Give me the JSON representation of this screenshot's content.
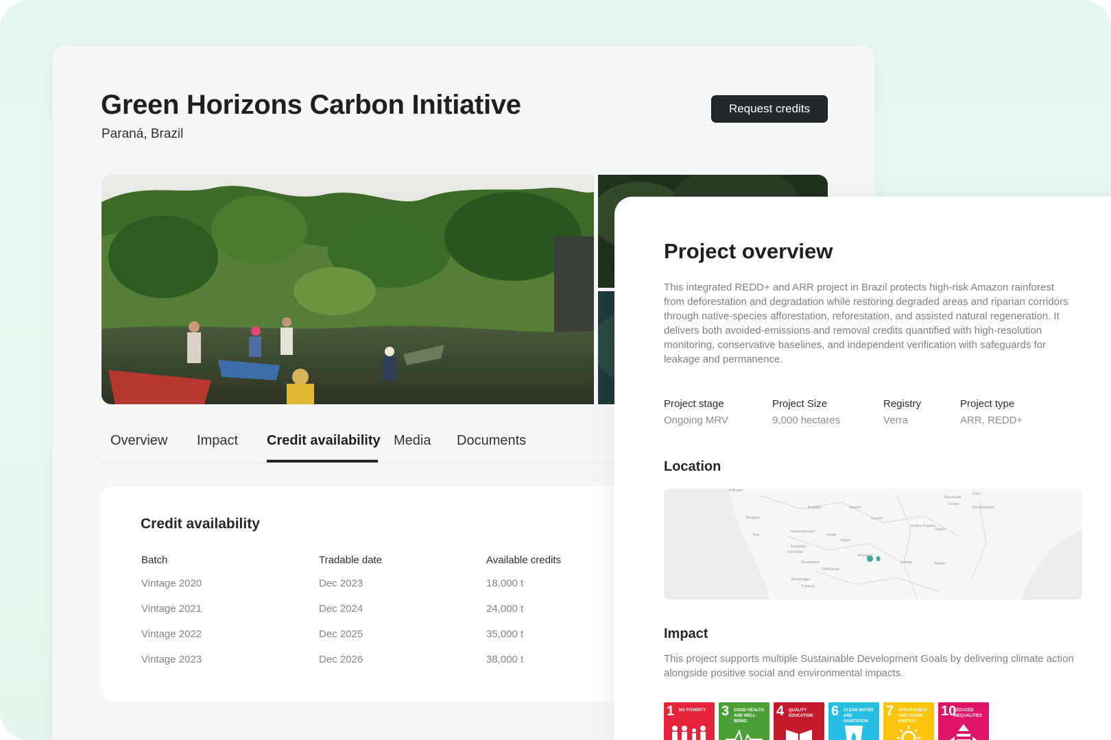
{
  "project": {
    "title": "Green Horizons Carbon Initiative",
    "location": "Paraná, Brazil",
    "request_label": "Request credits"
  },
  "tabs": [
    {
      "label": "Overview"
    },
    {
      "label": "Impact"
    },
    {
      "label": "Credit availability",
      "active": true
    },
    {
      "label": "Media"
    },
    {
      "label": "Documents"
    }
  ],
  "credits": {
    "title": "Credit availability",
    "headers": [
      "Batch",
      "Tradable date",
      "Available credits"
    ],
    "rows": [
      [
        "Vintage 2020",
        "Dec 2023",
        "18,000 t"
      ],
      [
        "Vintage 2021",
        "Dec 2024",
        "24,000 t"
      ],
      [
        "Vintage 2022",
        "Dec 2025",
        "35,000 t"
      ],
      [
        "Vintage 2023",
        "Dec 2026",
        "38,000 t"
      ]
    ]
  },
  "overview": {
    "title": "Project overview",
    "description": "This integrated REDD+ and ARR project in Brazil protects high-risk Amazon rainforest from deforestation and degradation while restoring degraded areas and riparian corridors through native-species afforestation, reforestation, and assisted natural regeneration. It delivers both avoided-emissions and removal credits quantified with high-resolution monitoring, conservative baselines, and independent verification with safeguards for leakage and permanence.",
    "meta": [
      {
        "label": "Project stage",
        "value": "Ongoing MRV"
      },
      {
        "label": "Project Size",
        "value": "9,000 hectares"
      },
      {
        "label": "Registry",
        "value": "Verra"
      },
      {
        "label": "Project type",
        "value": "ARR, REDD+"
      }
    ],
    "location_heading": "Location",
    "map_labels": [
      "Kolhapur",
      "Bagalkot",
      "Raichur",
      "Vijayawada",
      "Guntur",
      "Machilipatnam",
      "Belagavi",
      "Gadag-Betageri",
      "Kurnool",
      "Karnataka",
      "Hampi",
      "Andhra Pradesh",
      "Ongole",
      "Karnataka",
      "Ballari",
      "Anantapur",
      "Kadapa",
      "Nellore",
      "Davanagere",
      "Chitradurga",
      "Shivamogga",
      "Tumkuru",
      "Goa",
      "Eluru"
    ],
    "impact_heading": "Impact",
    "impact_description": "This project supports multiple Sustainable Development Goals by delivering climate action alongside positive social and environmental impacts.",
    "sdgs": [
      {
        "num": "1",
        "label": "No poverty",
        "color": "#e5243b",
        "icon": "people-icon"
      },
      {
        "num": "3",
        "label": "Good health and well-being",
        "color": "#4c9f38",
        "icon": "heartbeat-icon"
      },
      {
        "num": "4",
        "label": "Quality education",
        "color": "#c5192d",
        "icon": "book-icon"
      },
      {
        "num": "6",
        "label": "Clean water and sanitation",
        "color": "#26bde2",
        "icon": "water-drop-icon"
      },
      {
        "num": "7",
        "label": "Affordable and clean energy",
        "color": "#fcc30b",
        "icon": "sun-icon"
      },
      {
        "num": "10",
        "label": "Reduced inequalities",
        "color": "#dd1367",
        "icon": "equality-icon"
      }
    ]
  }
}
